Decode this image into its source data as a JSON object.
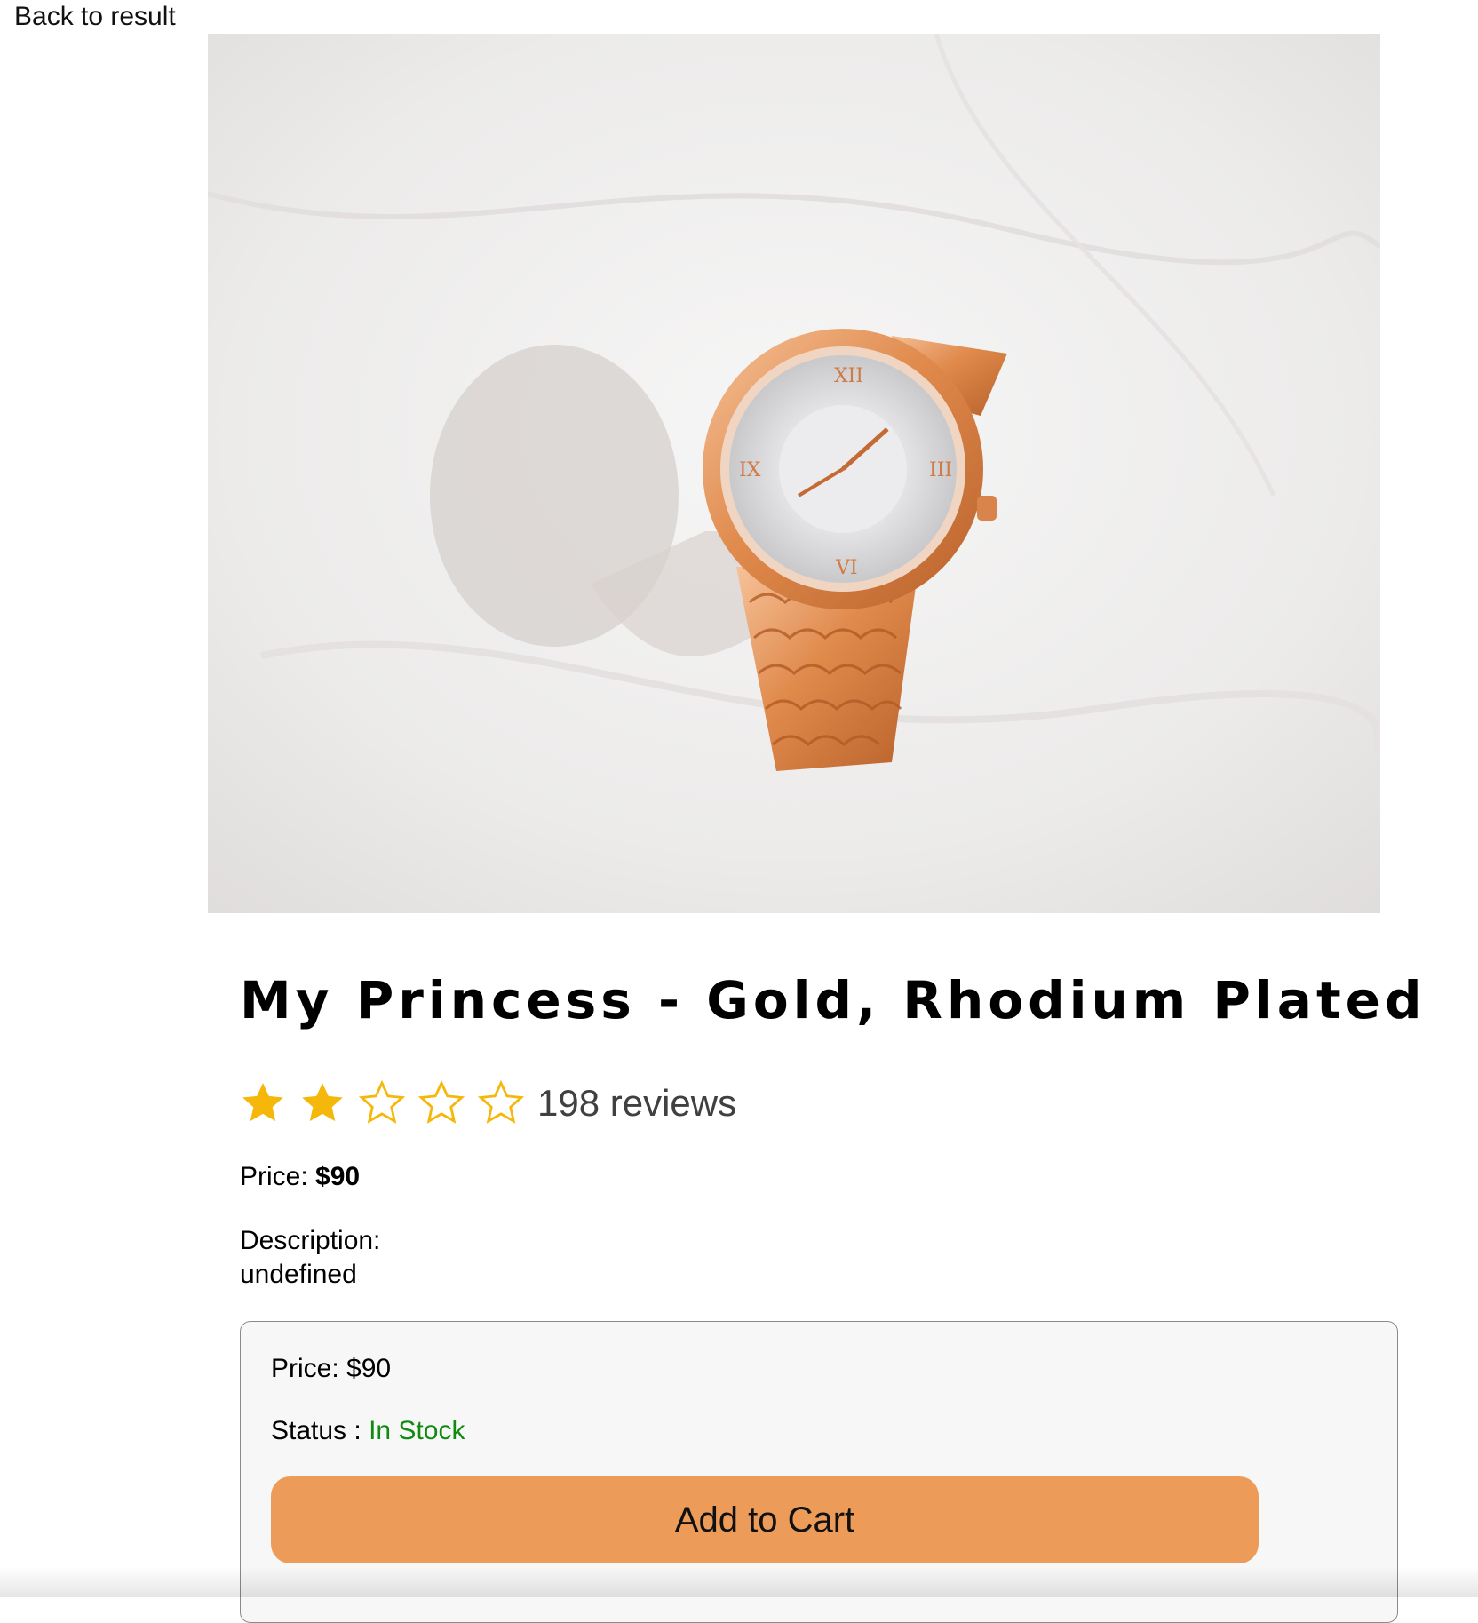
{
  "nav": {
    "back_label": "Back to result"
  },
  "product": {
    "image_icon": "watch-photo",
    "title": "My Princess - Gold, Rhodium Plated",
    "rating": 2,
    "rating_max": 5,
    "reviews_label": "198 reviews",
    "price_label": "Price: ",
    "price_value": "$90",
    "description_label": "Description:",
    "description_value": "undefined"
  },
  "cart": {
    "price_text": "Price: $90",
    "status_label": "Status : ",
    "status_value": "In Stock",
    "add_button_label": "Add to Cart"
  },
  "colors": {
    "star_filled": "#f5b80a",
    "star_empty_outline": "#f5b80a",
    "in_stock": "#118a11",
    "add_button": "#ec9c58"
  }
}
